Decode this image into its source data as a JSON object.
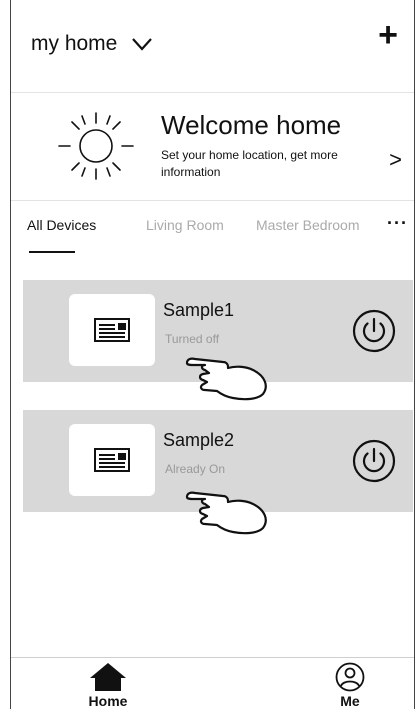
{
  "header": {
    "home_name": "my home",
    "add_label": "+"
  },
  "welcome": {
    "title": "Welcome home",
    "subtitle": "Set your home location, get more information",
    "arrow": ">"
  },
  "tabs": [
    {
      "label": "All Devices",
      "active": true
    },
    {
      "label": "Living Room",
      "active": false
    },
    {
      "label": "Master Bedroom",
      "active": false
    }
  ],
  "tabs_more": "···",
  "devices": [
    {
      "name": "Sample1",
      "status": "Turned off"
    },
    {
      "name": "Sample2",
      "status": "Already On"
    }
  ],
  "nav": {
    "home": "Home",
    "me": "Me"
  },
  "icons": {
    "sun": "sun-icon",
    "power": "power-icon",
    "device": "air-conditioner-icon",
    "hand": "pointing-hand-icon",
    "home": "home-icon",
    "me": "user-icon"
  },
  "colors": {
    "card_bg": "#d8d8d8",
    "status_text": "#999999",
    "inactive_tab": "#aaaaaa"
  }
}
